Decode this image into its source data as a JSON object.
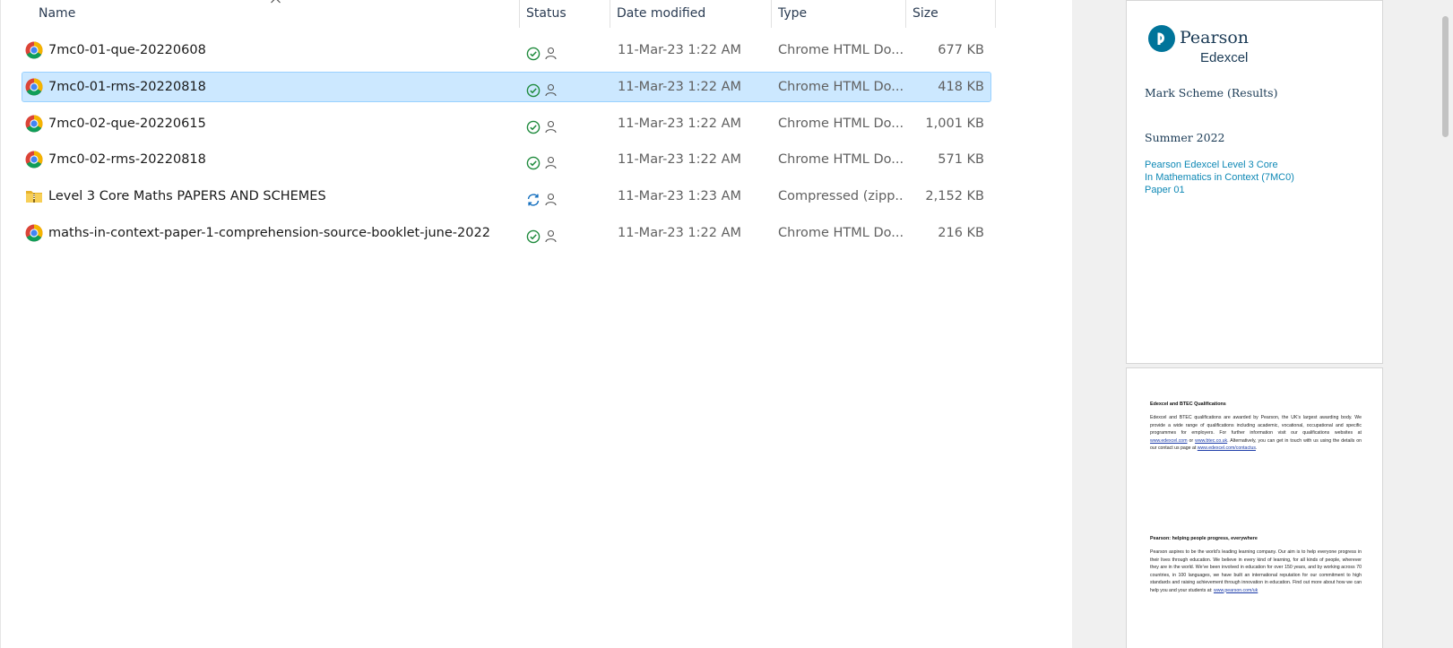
{
  "columns": {
    "name": "Name",
    "status": "Status",
    "date": "Date modified",
    "type": "Type",
    "size": "Size"
  },
  "files": [
    {
      "name": "7mc0-01-que-20220608",
      "icon": "chrome-icon",
      "status": "synced",
      "date": "11-Mar-23 1:22 AM",
      "type": "Chrome HTML Do...",
      "size": "677 KB",
      "selected": false
    },
    {
      "name": "7mc0-01-rms-20220818",
      "icon": "chrome-icon",
      "status": "synced",
      "date": "11-Mar-23 1:22 AM",
      "type": "Chrome HTML Do...",
      "size": "418 KB",
      "selected": true
    },
    {
      "name": "7mc0-02-que-20220615",
      "icon": "chrome-icon",
      "status": "synced",
      "date": "11-Mar-23 1:22 AM",
      "type": "Chrome HTML Do...",
      "size": "1,001 KB",
      "selected": false
    },
    {
      "name": "7mc0-02-rms-20220818",
      "icon": "chrome-icon",
      "status": "synced",
      "date": "11-Mar-23 1:22 AM",
      "type": "Chrome HTML Do...",
      "size": "571 KB",
      "selected": false
    },
    {
      "name": "Level 3 Core Maths PAPERS AND SCHEMES",
      "icon": "zip-folder-icon",
      "status": "syncing",
      "date": "11-Mar-23 1:23 AM",
      "type": "Compressed (zipp...",
      "size": "2,152 KB",
      "selected": false
    },
    {
      "name": "maths-in-context-paper-1-comprehension-source-booklet-june-2022",
      "icon": "chrome-icon",
      "status": "synced",
      "date": "11-Mar-23 1:22 AM",
      "type": "Chrome HTML Do...",
      "size": "216 KB",
      "selected": false
    }
  ],
  "preview": {
    "page1": {
      "logo_name": "Pearson",
      "logo_sub": "Edexcel",
      "title": "Mark Scheme (Results)",
      "session": "Summer 2022",
      "lines": [
        "Pearson Edexcel Level 3 Core",
        "In Mathematics in Context (7MC0)",
        "Paper 01"
      ]
    },
    "page2": {
      "heading1": "Edexcel and BTEC Qualifications",
      "body1a": "Edexcel and BTEC qualifications are awarded by Pearson, the UK’s largest awarding body. We provide a wide range of qualifications including academic, vocational, occupational and specific programmes for employers. For further information visit our qualifications websites at",
      "link1": "www.edexcel.com",
      "body1b": "or",
      "link2": "www.btec.co.uk",
      "body1c": ". Alternatively, you can get in touch with us using the details on our contact us page at",
      "link3": "www.edexcel.com/contactus",
      "body1d": ".",
      "heading2": "Pearson: helping people progress, everywhere",
      "body2": "Pearson aspires to be the world’s leading learning company. Our aim is to help everyone progress in their lives through education. We believe in every kind of learning, for all kinds of people, wherever they are in the world. We’ve been involved in education for over 150 years, and by working across 70 countries, in 100 languages, we have built an international reputation for our commitment to high standards and raising achievement through innovation in education. Find out more about how we can help you and your students at:",
      "link4": "www.pearson.com/uk"
    }
  },
  "colors": {
    "selection": "#cce8ff",
    "synced_green": "#1e8a3c",
    "syncing_blue": "#0f6cbd",
    "pearson_blue": "#00749a"
  }
}
